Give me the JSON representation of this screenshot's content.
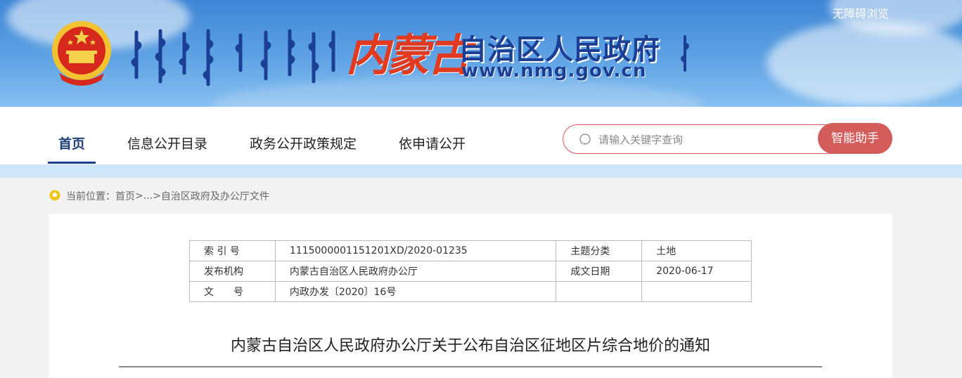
{
  "header": {
    "accessibility_label": "无障碍浏览",
    "brand_calligraphy": "内蒙古",
    "brand_title": "自治区人民政府",
    "brand_url": "www.nmg.gov.cn",
    "accent_color": "#1b3f95",
    "brand_red": "#e03a21"
  },
  "nav": {
    "items": [
      {
        "label": "首页",
        "active": true
      },
      {
        "label": "信息公开目录",
        "active": false
      },
      {
        "label": "政务公开政策规定",
        "active": false
      },
      {
        "label": "依申请公开",
        "active": false
      }
    ],
    "search": {
      "placeholder": "请输入关键字查询",
      "value": "",
      "icon": "search-icon"
    },
    "assistant_label": "智能助手",
    "assistant_color": "#d45d5c"
  },
  "breadcrumb": {
    "prefix": "当前位置：",
    "items": [
      "首页",
      "...",
      "自治区政府及办公厅文件"
    ],
    "separator": ">",
    "icon": "location-pin-icon"
  },
  "meta_table": {
    "rows": [
      [
        "索 引 号",
        "1115000001151201XD/2020-01235",
        "主题分类",
        "土地"
      ],
      [
        "发布机构",
        "内蒙古自治区人民政府办公厅",
        "成文日期",
        "2020-06-17"
      ],
      [
        "文　　号",
        "内政办发〔2020〕16号",
        "",
        ""
      ]
    ]
  },
  "document": {
    "title": "内蒙古自治区人民政府办公厅关于公布自治区征地区片综合地价的通知"
  }
}
